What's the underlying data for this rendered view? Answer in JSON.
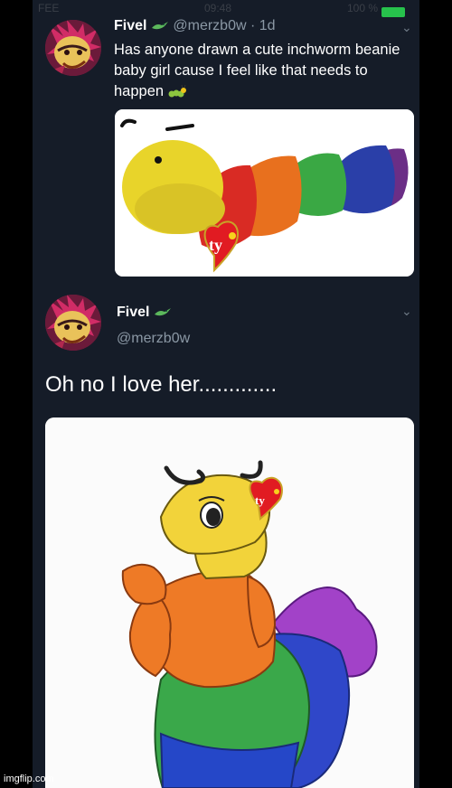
{
  "status_bar": {
    "carrier": "FEE",
    "time": "09:48",
    "battery": "100 %"
  },
  "tweet1": {
    "display_name": "Fivel",
    "handle": "@merzb0w",
    "separator": "·",
    "timestamp": "1d",
    "text": "Has anyone drawn a cute inchworm beanie baby girl cause I feel like that needs to happen",
    "name_emoji": "lizard-emoji",
    "text_emoji": "caterpillar-emoji"
  },
  "tweet2": {
    "display_name": "Fivel",
    "handle": "@merzb0w",
    "text": "Oh no I love her.............",
    "name_emoji": "lizard-emoji"
  },
  "watermark": "imgflip.com",
  "colors": {
    "background": "#151c28",
    "name": "#ffffff",
    "handle": "#8b98a5",
    "battery": "#27c24c"
  }
}
